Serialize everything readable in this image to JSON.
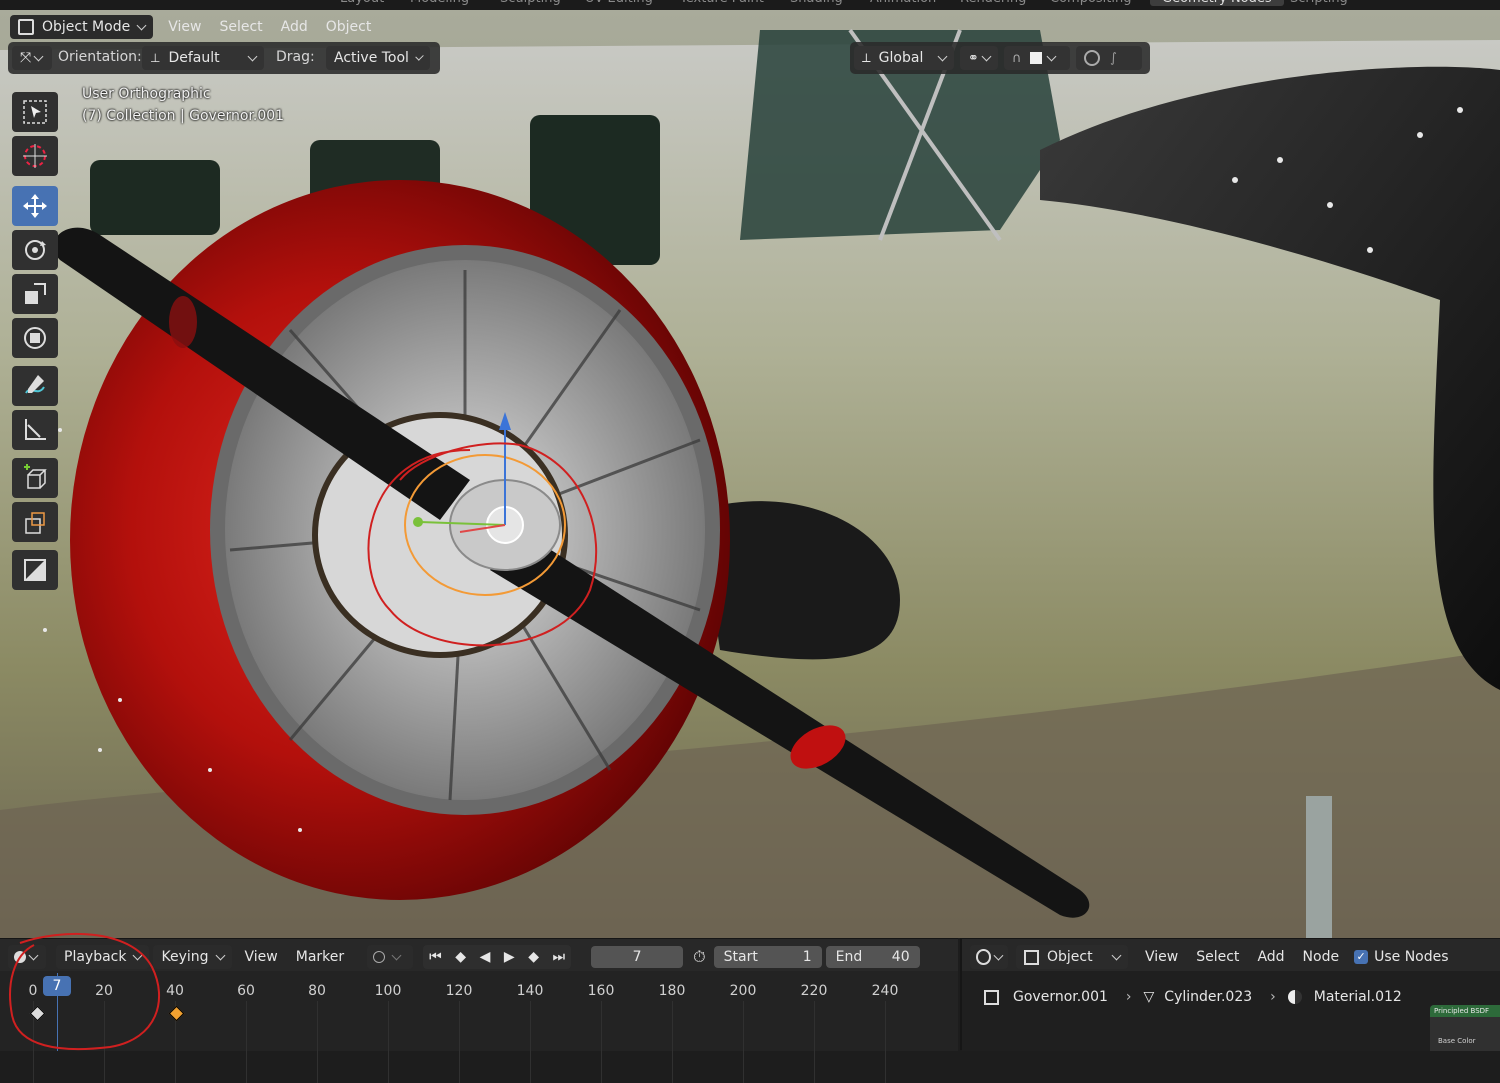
{
  "workspaces": [
    "Layout",
    "Modeling",
    "Sculpting",
    "UV Editing",
    "Texture Paint",
    "Shading",
    "Animation",
    "Rendering",
    "Compositing",
    "Geometry Nodes",
    "Scripting"
  ],
  "active_workspace": "Geometry Nodes",
  "viewport": {
    "mode_label": "Object Mode",
    "menus": [
      "View",
      "Select",
      "Add",
      "Object"
    ],
    "orientation_label": "Orientation:",
    "orientation_value": "Default",
    "drag_label": "Drag:",
    "drag_value": "Active Tool",
    "transform_orientation": "Global",
    "overlay_line1": "User Orthographic",
    "overlay_line2": "(7) Collection | Governor.001",
    "tools": [
      "select-box-icon",
      "cursor-icon",
      "move-icon",
      "rotate-icon",
      "scale-icon",
      "transform-icon",
      "annotate-icon",
      "measure-icon",
      "add-cube-icon",
      "extrude-icon",
      "image-icon"
    ]
  },
  "timeline": {
    "menus": [
      "Playback",
      "Keying",
      "View",
      "Marker"
    ],
    "current_frame": "7",
    "start_label": "Start",
    "start_value": "1",
    "end_label": "End",
    "end_value": "40",
    "ticks": [
      "0",
      "20",
      "40",
      "60",
      "80",
      "100",
      "120",
      "140",
      "160",
      "180",
      "200",
      "220",
      "240"
    ],
    "playhead_label": "7"
  },
  "node_editor": {
    "context": "Object",
    "menus": [
      "View",
      "Select",
      "Add",
      "Node"
    ],
    "use_nodes_label": "Use Nodes",
    "use_nodes_checked": true,
    "breadcrumb": [
      "Governor.001",
      "Cylinder.023",
      "Material.012"
    ],
    "node_title": "Principled BSDF",
    "node_socket": "Base Color"
  },
  "colors": {
    "accent": "#4772b3",
    "keyframe_selected": "#f0a030",
    "annotation": "#d02020"
  }
}
